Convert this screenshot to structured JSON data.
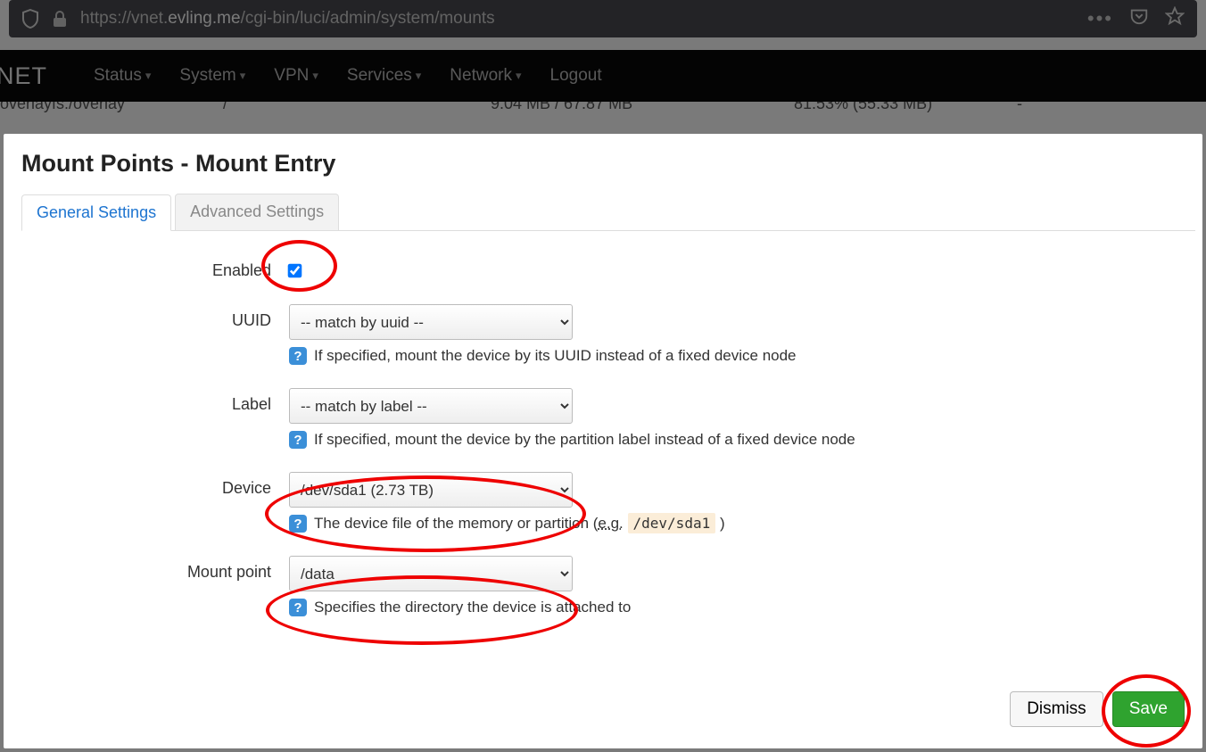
{
  "url": {
    "scheme": "https://",
    "sub": "vnet.",
    "host": "evling.me",
    "path": "/cgi-bin/luci/admin/system/mounts"
  },
  "nav": {
    "brand": "NET",
    "items": [
      "Status",
      "System",
      "VPN",
      "Services",
      "Network"
    ],
    "logout": "Logout"
  },
  "bg": {
    "fs": "overlayfs:/overlay",
    "mount": "/",
    "avail": "9.04 MB / 67.87 MB",
    "used": "81.53% (55.33 MB)",
    "dash": "-"
  },
  "modal": {
    "title": "Mount Points - Mount Entry",
    "tabs": {
      "general": "General Settings",
      "advanced": "Advanced Settings"
    },
    "enabled_label": "Enabled",
    "uuid": {
      "label": "UUID",
      "value": "-- match by uuid --",
      "hint": "If specified, mount the device by its UUID instead of a fixed device node"
    },
    "plabel": {
      "label": "Label",
      "value": "-- match by label --",
      "hint": "If specified, mount the device by the partition label instead of a fixed device node"
    },
    "device": {
      "label": "Device",
      "value": "/dev/sda1 (2.73 TB)",
      "hint_pre": "The device file of the memory or partition (",
      "eg": "e.g.",
      "code": "/dev/sda1",
      "hint_post": ")"
    },
    "mountpoint": {
      "label": "Mount point",
      "value": "/data",
      "hint": "Specifies the directory the device is attached to"
    },
    "dismiss": "Dismiss",
    "save": "Save"
  }
}
